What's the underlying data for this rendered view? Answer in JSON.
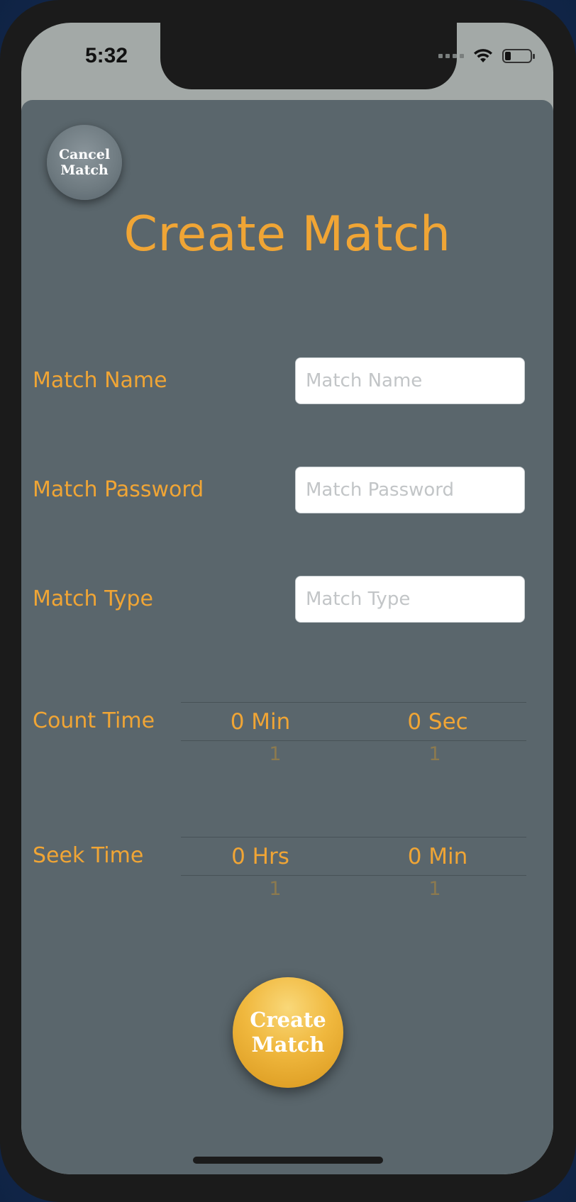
{
  "status_bar": {
    "time": "5:32",
    "icons": [
      "signal-dots-icon",
      "wifi-icon",
      "battery-icon"
    ]
  },
  "header": {
    "cancel_button_label": "Cancel\nMatch",
    "title": "Create Match"
  },
  "form": {
    "match_name": {
      "label": "Match Name",
      "value": "",
      "placeholder": "Match Name"
    },
    "match_password": {
      "label": "Match Password",
      "value": "",
      "placeholder": "Match Password"
    },
    "match_type": {
      "label": "Match Type",
      "value": "",
      "placeholder": "Match Type"
    }
  },
  "count_time": {
    "label": "Count Time",
    "columns": [
      {
        "selected": "0 Min",
        "next": "1"
      },
      {
        "selected": "0 Sec",
        "next": "1"
      }
    ]
  },
  "seek_time": {
    "label": "Seek Time",
    "columns": [
      {
        "selected": "0 Hrs",
        "next": "1"
      },
      {
        "selected": "0 Min",
        "next": "1"
      }
    ]
  },
  "footer": {
    "create_button_label": "Create\nMatch"
  },
  "colors": {
    "accent": "#f0a535",
    "sheet_background": "#5a666c",
    "create_button": "#f0b83e",
    "cancel_button": "#6e7a80"
  }
}
